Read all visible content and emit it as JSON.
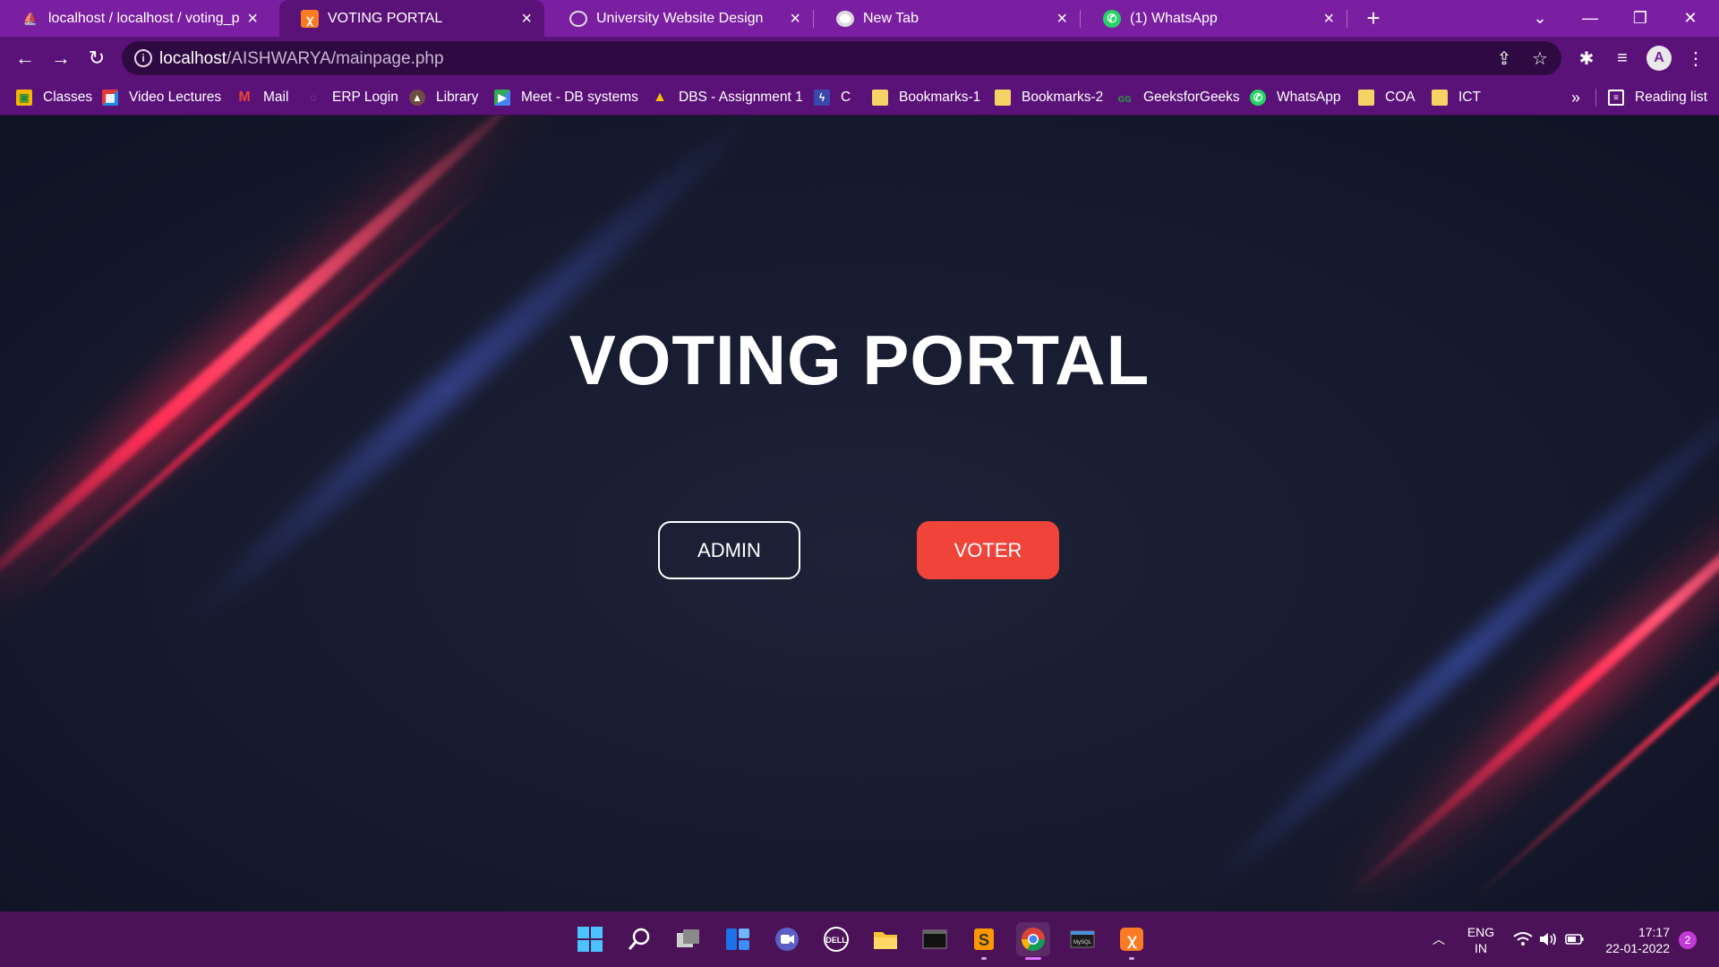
{
  "browser": {
    "tabs": [
      {
        "title": "localhost / localhost / voting_por",
        "favicon": "phpmyadmin-icon",
        "active": false
      },
      {
        "title": "VOTING PORTAL",
        "favicon": "xampp-icon",
        "active": true
      },
      {
        "title": "University Website Design",
        "favicon": "globe-icon",
        "active": false
      },
      {
        "title": "New Tab",
        "favicon": "chrome-icon",
        "active": false
      },
      {
        "title": "(1) WhatsApp",
        "favicon": "whatsapp-icon",
        "active": false
      }
    ],
    "address": {
      "host": "localhost",
      "path": "/AISHWARYA/mainpage.php"
    },
    "profile_initial": "A",
    "bookmarks": [
      {
        "label": "Classes",
        "icon": "google-classroom-icon"
      },
      {
        "label": "Video Lectures",
        "icon": "video-lectures-icon"
      },
      {
        "label": "Mail",
        "icon": "gmail-icon"
      },
      {
        "label": "ERP Login",
        "icon": "erp-icon"
      },
      {
        "label": "Library",
        "icon": "library-icon"
      },
      {
        "label": "Meet - DB systems",
        "icon": "meet-icon"
      },
      {
        "label": "DBS - Assignment 1",
        "icon": "google-drive-icon"
      },
      {
        "label": "C",
        "icon": "bolt-icon"
      },
      {
        "label": "Bookmarks-1",
        "icon": "folder-icon"
      },
      {
        "label": "Bookmarks-2",
        "icon": "folder-icon"
      },
      {
        "label": "GeeksforGeeks",
        "icon": "geeksforgeeks-icon"
      },
      {
        "label": "WhatsApp",
        "icon": "whatsapp-icon"
      },
      {
        "label": "COA",
        "icon": "folder-icon"
      },
      {
        "label": "ICT",
        "icon": "folder-icon"
      }
    ],
    "more_bookmarks": "»",
    "reading_list": "Reading list"
  },
  "page": {
    "title": "VOTING PORTAL",
    "admin_label": "ADMIN",
    "voter_label": "VOTER"
  },
  "taskbar": {
    "apps": [
      "windows-start-icon",
      "search-icon",
      "task-view-icon",
      "widgets-icon",
      "teams-chat-icon",
      "dell-icon",
      "file-explorer-icon",
      "terminal-icon",
      "sublime-text-icon",
      "chrome-icon",
      "mysql-icon",
      "xampp-icon"
    ],
    "lang_line1": "ENG",
    "lang_line2": "IN",
    "time": "17:17",
    "date": "22-01-2022",
    "notifications": "2"
  },
  "colors": {
    "tab_strip": "#7b1fa2",
    "toolbar": "#5a1278",
    "voter_button": "#f0443a",
    "page_background": "#161a2d",
    "taskbar": "#4b1257"
  }
}
